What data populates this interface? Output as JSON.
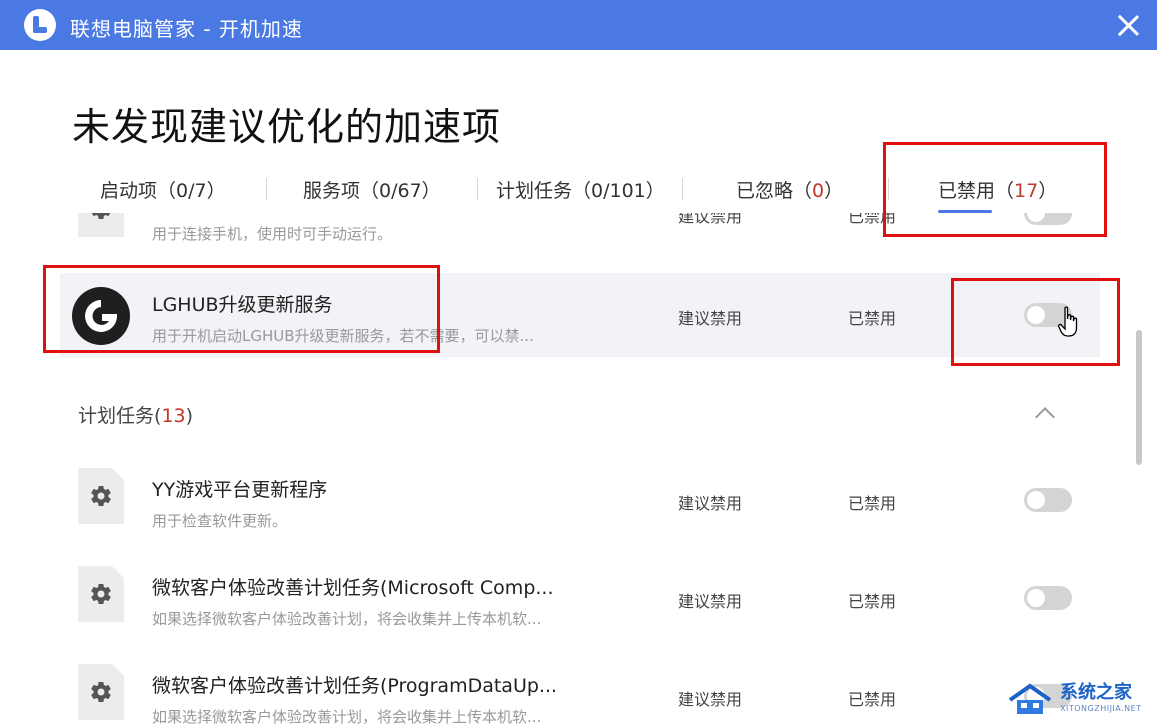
{
  "window": {
    "title": "联想电脑管家 - 开机加速"
  },
  "page": {
    "title": "未发现建议优化的加速项"
  },
  "tabs": [
    {
      "label": "启动项（0/7）"
    },
    {
      "label": "服务项（0/67）"
    },
    {
      "label": "计划任务（0/101）"
    },
    {
      "label_prefix": "已忽略（",
      "count": "0",
      "label_suffix": "）"
    },
    {
      "label_prefix": "已禁用（",
      "count": "17",
      "label_suffix": "）",
      "active": true
    }
  ],
  "rows_top": [
    {
      "name": "",
      "desc": "用于连接手机，使用时可手动运行。",
      "suggest": "建议禁用",
      "status": "已禁用",
      "icon": "gear-icon",
      "partial": true
    },
    {
      "name": "LGHUB升级更新服务",
      "desc": "用于开机启动LGHUB升级更新服务，若不需要，可以禁...",
      "suggest": "建议禁用",
      "status": "已禁用",
      "icon": "logitech-g-icon",
      "highlight": true
    }
  ],
  "section": {
    "label": "计划任务",
    "count_prefix": "(",
    "count": "13",
    "count_suffix": ")"
  },
  "rows_tasks": [
    {
      "name": "YY游戏平台更新程序",
      "desc": "用于检查软件更新。",
      "suggest": "建议禁用",
      "status": "已禁用",
      "icon": "gear-icon"
    },
    {
      "name": "微软客户体验改善计划任务(Microsoft Comp...",
      "desc": "如果选择微软客户体验改善计划，将会收集并上传本机软...",
      "suggest": "建议禁用",
      "status": "已禁用",
      "icon": "gear-icon"
    },
    {
      "name": "微软客户体验改善计划任务(ProgramDataUp...",
      "desc": "如果选择微软客户体验改善计划，将会收集并上传本机软...",
      "suggest": "建议禁用",
      "status": "已禁用",
      "icon": "gear-icon"
    }
  ],
  "watermark": {
    "text": "系统之家",
    "sub": "XITONGZHIJIA.NET"
  },
  "colors": {
    "titlebar": "#4a79e4",
    "accent": "#4a79e4",
    "count_red": "#c0392b",
    "highlight_box": "#e01010"
  }
}
